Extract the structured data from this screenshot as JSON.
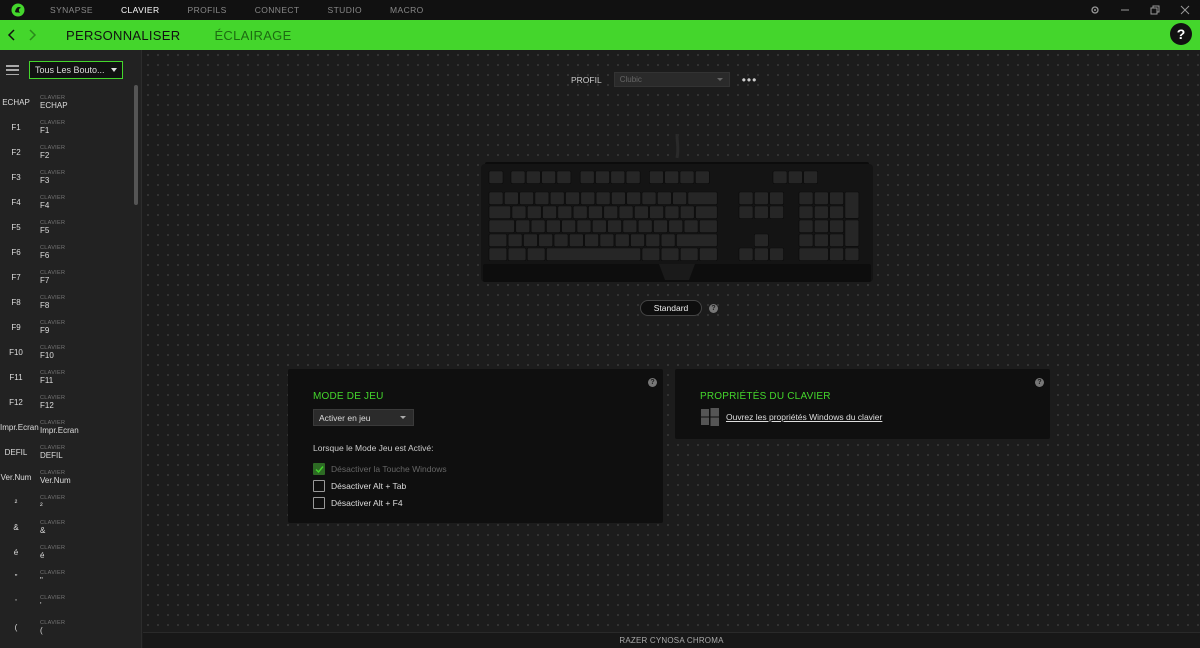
{
  "titlebar": {
    "tabs": [
      {
        "label": "SYNAPSE",
        "active": false
      },
      {
        "label": "CLAVIER",
        "active": true
      },
      {
        "label": "PROFILS",
        "active": false
      },
      {
        "label": "CONNECT",
        "active": false
      },
      {
        "label": "STUDIO",
        "active": false
      },
      {
        "label": "MACRO",
        "active": false
      }
    ]
  },
  "subnav": {
    "tabs": [
      {
        "label": "PERSONNALISER",
        "active": true
      },
      {
        "label": "ÉCLAIRAGE",
        "active": false
      }
    ],
    "help": "?"
  },
  "sidebar": {
    "filter": "Tous Les Bouto...",
    "keys": [
      {
        "key": "ECHAP",
        "category": "CLAVIER",
        "value": "ECHAP"
      },
      {
        "key": "F1",
        "category": "CLAVIER",
        "value": "F1"
      },
      {
        "key": "F2",
        "category": "CLAVIER",
        "value": "F2"
      },
      {
        "key": "F3",
        "category": "CLAVIER",
        "value": "F3"
      },
      {
        "key": "F4",
        "category": "CLAVIER",
        "value": "F4"
      },
      {
        "key": "F5",
        "category": "CLAVIER",
        "value": "F5"
      },
      {
        "key": "F6",
        "category": "CLAVIER",
        "value": "F6"
      },
      {
        "key": "F7",
        "category": "CLAVIER",
        "value": "F7"
      },
      {
        "key": "F8",
        "category": "CLAVIER",
        "value": "F8"
      },
      {
        "key": "F9",
        "category": "CLAVIER",
        "value": "F9"
      },
      {
        "key": "F10",
        "category": "CLAVIER",
        "value": "F10"
      },
      {
        "key": "F11",
        "category": "CLAVIER",
        "value": "F11"
      },
      {
        "key": "F12",
        "category": "CLAVIER",
        "value": "F12"
      },
      {
        "key": "Impr.Ecran",
        "category": "CLAVIER",
        "value": "Impr.Ecran"
      },
      {
        "key": "DEFIL",
        "category": "CLAVIER",
        "value": "DEFIL"
      },
      {
        "key": "Ver.Num",
        "category": "CLAVIER",
        "value": "Ver.Num"
      },
      {
        "key": "²",
        "category": "CLAVIER",
        "value": "²"
      },
      {
        "key": "&",
        "category": "CLAVIER",
        "value": "&"
      },
      {
        "key": "é",
        "category": "CLAVIER",
        "value": "é"
      },
      {
        "key": "\"",
        "category": "CLAVIER",
        "value": "\""
      },
      {
        "key": "'",
        "category": "CLAVIER",
        "value": "'"
      },
      {
        "key": "(",
        "category": "CLAVIER",
        "value": "("
      },
      {
        "key": "",
        "category": "CLAVIER",
        "value": ""
      }
    ]
  },
  "profile": {
    "label": "PROFIL",
    "value": "Clubic",
    "more": "•••"
  },
  "keyboard_mode": "Standard",
  "game_mode": {
    "title": "MODE DE JEU",
    "dropdown": "Activer en jeu",
    "description": "Lorsque le Mode Jeu est Activé:",
    "options": [
      {
        "label": "Désactiver la Touche Windows",
        "checked": true,
        "disabled": true
      },
      {
        "label": "Désactiver Alt + Tab",
        "checked": false,
        "disabled": false
      },
      {
        "label": "Désactiver Alt + F4",
        "checked": false,
        "disabled": false
      }
    ]
  },
  "keyboard_props": {
    "title": "PROPRIÉTÉS DU CLAVIER",
    "link": "Ouvrez les propriétés Windows du clavier"
  },
  "status": {
    "device": "RAZER CYNOSA CHROMA"
  },
  "colors": {
    "accent": "#44d62c",
    "bg": "#1c1c1c",
    "panel": "#0f0f0f"
  }
}
